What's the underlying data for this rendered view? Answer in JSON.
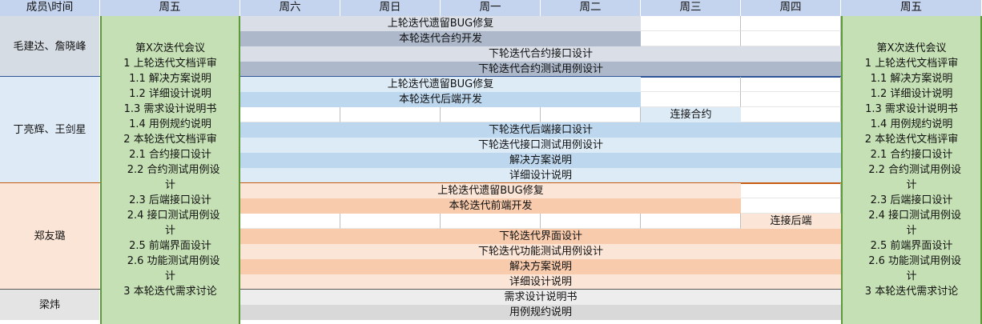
{
  "header": {
    "corner": "成员\\时间",
    "days": [
      "周五",
      "周六",
      "周日",
      "周一",
      "周二",
      "周三",
      "周四",
      "周五"
    ]
  },
  "members": [
    {
      "name": "毛建达、詹晓峰",
      "color": "#d6dce4",
      "tasks": [
        {
          "label": "上轮迭代遗留BUG修复",
          "start": 1,
          "end": 5,
          "color": "#d9dee7"
        },
        {
          "label": "本轮迭代合约开发",
          "start": 1,
          "end": 5,
          "color": "#adb9ca"
        },
        {
          "label": "下轮迭代合约接口设计",
          "start": 1,
          "end": 7,
          "color": "#d9dee7"
        },
        {
          "label": "下轮迭代合约测试用例设计",
          "start": 1,
          "end": 7,
          "color": "#adb9ca"
        }
      ]
    },
    {
      "name": "丁亮辉、王剑星",
      "color": "#deebf7",
      "tasks": [
        {
          "label": "上轮迭代遗留BUG修复",
          "start": 1,
          "end": 5,
          "color": "#ddebf7"
        },
        {
          "label": "本轮迭代后端开发",
          "start": 1,
          "end": 5,
          "color": "#bdd7ee"
        },
        {
          "label": "连接合约",
          "start": 5,
          "end": 6,
          "color": "#ddebf7"
        },
        {
          "label": "下轮迭代后端接口设计",
          "start": 1,
          "end": 7,
          "color": "#bdd7ee"
        },
        {
          "label": "下轮迭代接口测试用例设计",
          "start": 1,
          "end": 7,
          "color": "#ddebf7"
        },
        {
          "label": "解决方案说明",
          "start": 1,
          "end": 7,
          "color": "#bdd7ee"
        },
        {
          "label": "详细设计说明",
          "start": 1,
          "end": 7,
          "color": "#ddebf7"
        }
      ]
    },
    {
      "name": "郑友璐",
      "color": "#fbe5d6",
      "tasks": [
        {
          "label": "上轮迭代遗留BUG修复",
          "start": 1,
          "end": 6,
          "color": "#fbe5d6"
        },
        {
          "label": "本轮迭代前端开发",
          "start": 1,
          "end": 6,
          "color": "#f8cbad"
        },
        {
          "label": "连接后端",
          "start": 6,
          "end": 7,
          "color": "#fbe5d6"
        },
        {
          "label": "下轮迭代界面设计",
          "start": 1,
          "end": 7,
          "color": "#f8cbad"
        },
        {
          "label": "下轮迭代功能测试用例设计",
          "start": 1,
          "end": 7,
          "color": "#fbe5d6"
        },
        {
          "label": "解决方案说明",
          "start": 1,
          "end": 7,
          "color": "#f8cbad"
        },
        {
          "label": "详细设计说明",
          "start": 1,
          "end": 7,
          "color": "#fbe5d6"
        }
      ]
    },
    {
      "name": "梁炜",
      "color": "#e4e4e4",
      "tasks": [
        {
          "label": "需求设计说明书",
          "start": 1,
          "end": 7,
          "color": "#ededed"
        },
        {
          "label": "用例规约说明",
          "start": 1,
          "end": 7,
          "color": "#d9d9d9"
        }
      ]
    }
  ],
  "agenda": {
    "color": "#c5e0b4",
    "lines": [
      "第X次迭代会议",
      "1 上轮迭代文档评审",
      "1.1 解决方案说明",
      "1.2 详细设计说明",
      "1.3 需求设计说明书",
      "1.4 用例规约说明",
      "2 本轮迭代文档评审",
      "2.1 合约接口设计",
      "  2.2 合约测试用例设",
      "计",
      "2.3 后端接口设计",
      "  2.4 接口测试用例设",
      "计",
      "2.5 前端界面设计",
      "  2.6 功能测试用例设",
      "计",
      "3 本轮迭代需求讨论"
    ]
  },
  "colors": {
    "header": "#c5d4ee",
    "grid_line": "#bfbfbf",
    "agenda_border": "#5e9a3a",
    "blue_separator": "#2f5597",
    "orange_separator": "#c55a11",
    "gray_separator": "#595959"
  }
}
